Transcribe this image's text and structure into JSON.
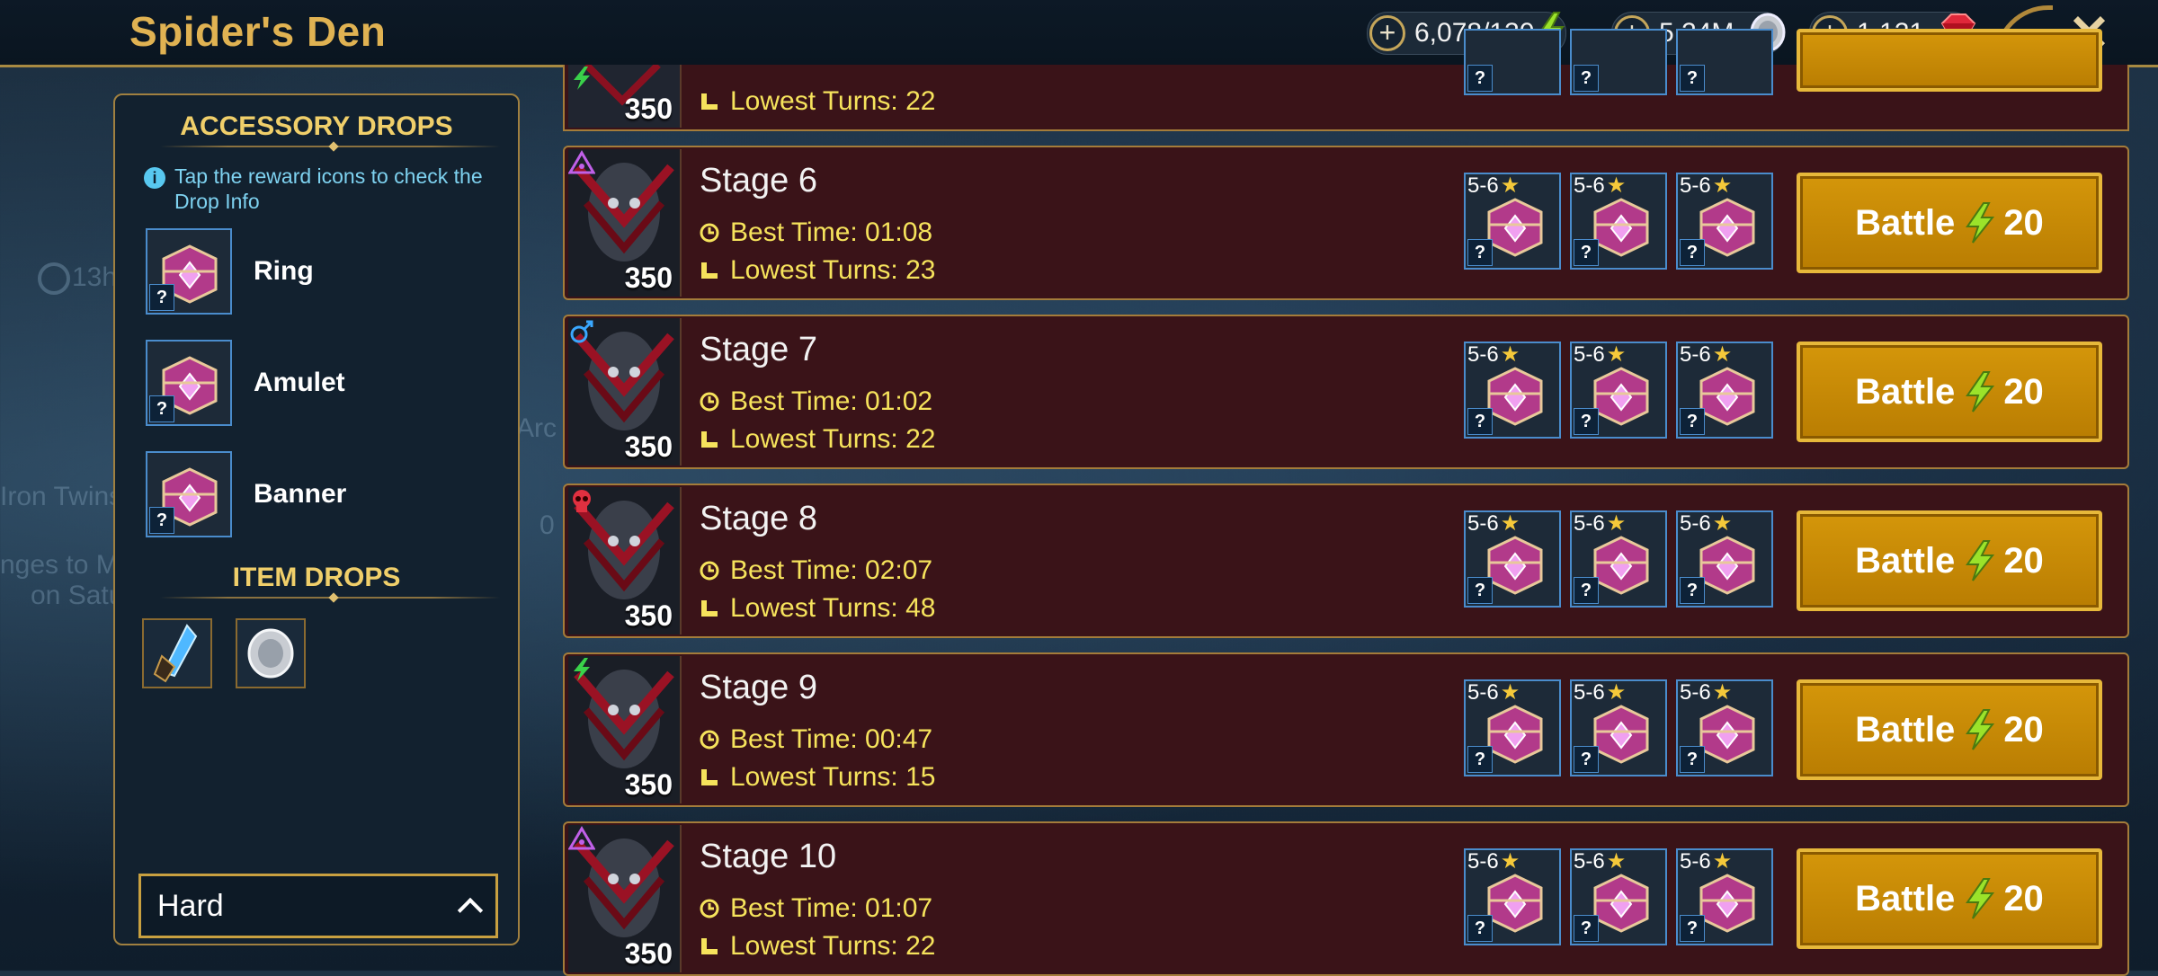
{
  "header": {
    "title": "Spider's Den",
    "energy": "6,078/130",
    "silver": "5.24M",
    "gems": "1,121"
  },
  "background_text": {
    "timer": "13h",
    "name": "Iron Twins",
    "line1": "nges to Magic Af",
    "line2": "on Satu",
    "misc": "Arc",
    "misc2": "0"
  },
  "left_panel": {
    "accessory_header": "ACCESSORY DROPS",
    "info_text": "Tap the reward icons to check the Drop Info",
    "accessories": [
      {
        "label": "Ring",
        "q": "?"
      },
      {
        "label": "Amulet",
        "q": "?"
      },
      {
        "label": "Banner",
        "q": "?"
      }
    ],
    "item_header": "ITEM DROPS",
    "items": [
      "blue-shard-icon",
      "silver-coin-icon"
    ],
    "difficulty": "Hard"
  },
  "partial_stage": {
    "power": "350",
    "lowest_turns": "Lowest Turns: 22"
  },
  "stages": [
    {
      "name": "Stage 6",
      "power": "350",
      "affinity": "void",
      "best_time": "Best Time: 01:08",
      "lowest_turns": "Lowest Turns: 23"
    },
    {
      "name": "Stage 7",
      "power": "350",
      "affinity": "magic",
      "best_time": "Best Time: 01:02",
      "lowest_turns": "Lowest Turns: 22"
    },
    {
      "name": "Stage 8",
      "power": "350",
      "affinity": "force",
      "best_time": "Best Time: 02:07",
      "lowest_turns": "Lowest Turns: 48"
    },
    {
      "name": "Stage 9",
      "power": "350",
      "affinity": "spirit",
      "best_time": "Best Time: 00:47",
      "lowest_turns": "Lowest Turns: 15"
    },
    {
      "name": "Stage 10",
      "power": "350",
      "affinity": "void",
      "best_time": "Best Time: 01:07",
      "lowest_turns": "Lowest Turns: 22"
    }
  ],
  "drop_rank": "5-6",
  "drop_q": "?",
  "battle": {
    "label": "Battle",
    "cost": "20"
  },
  "colors": {
    "gold": "#e0b252",
    "stage_bg": "#3a1318",
    "stat_yellow": "#f6e35c",
    "battle": "#c98a06"
  }
}
